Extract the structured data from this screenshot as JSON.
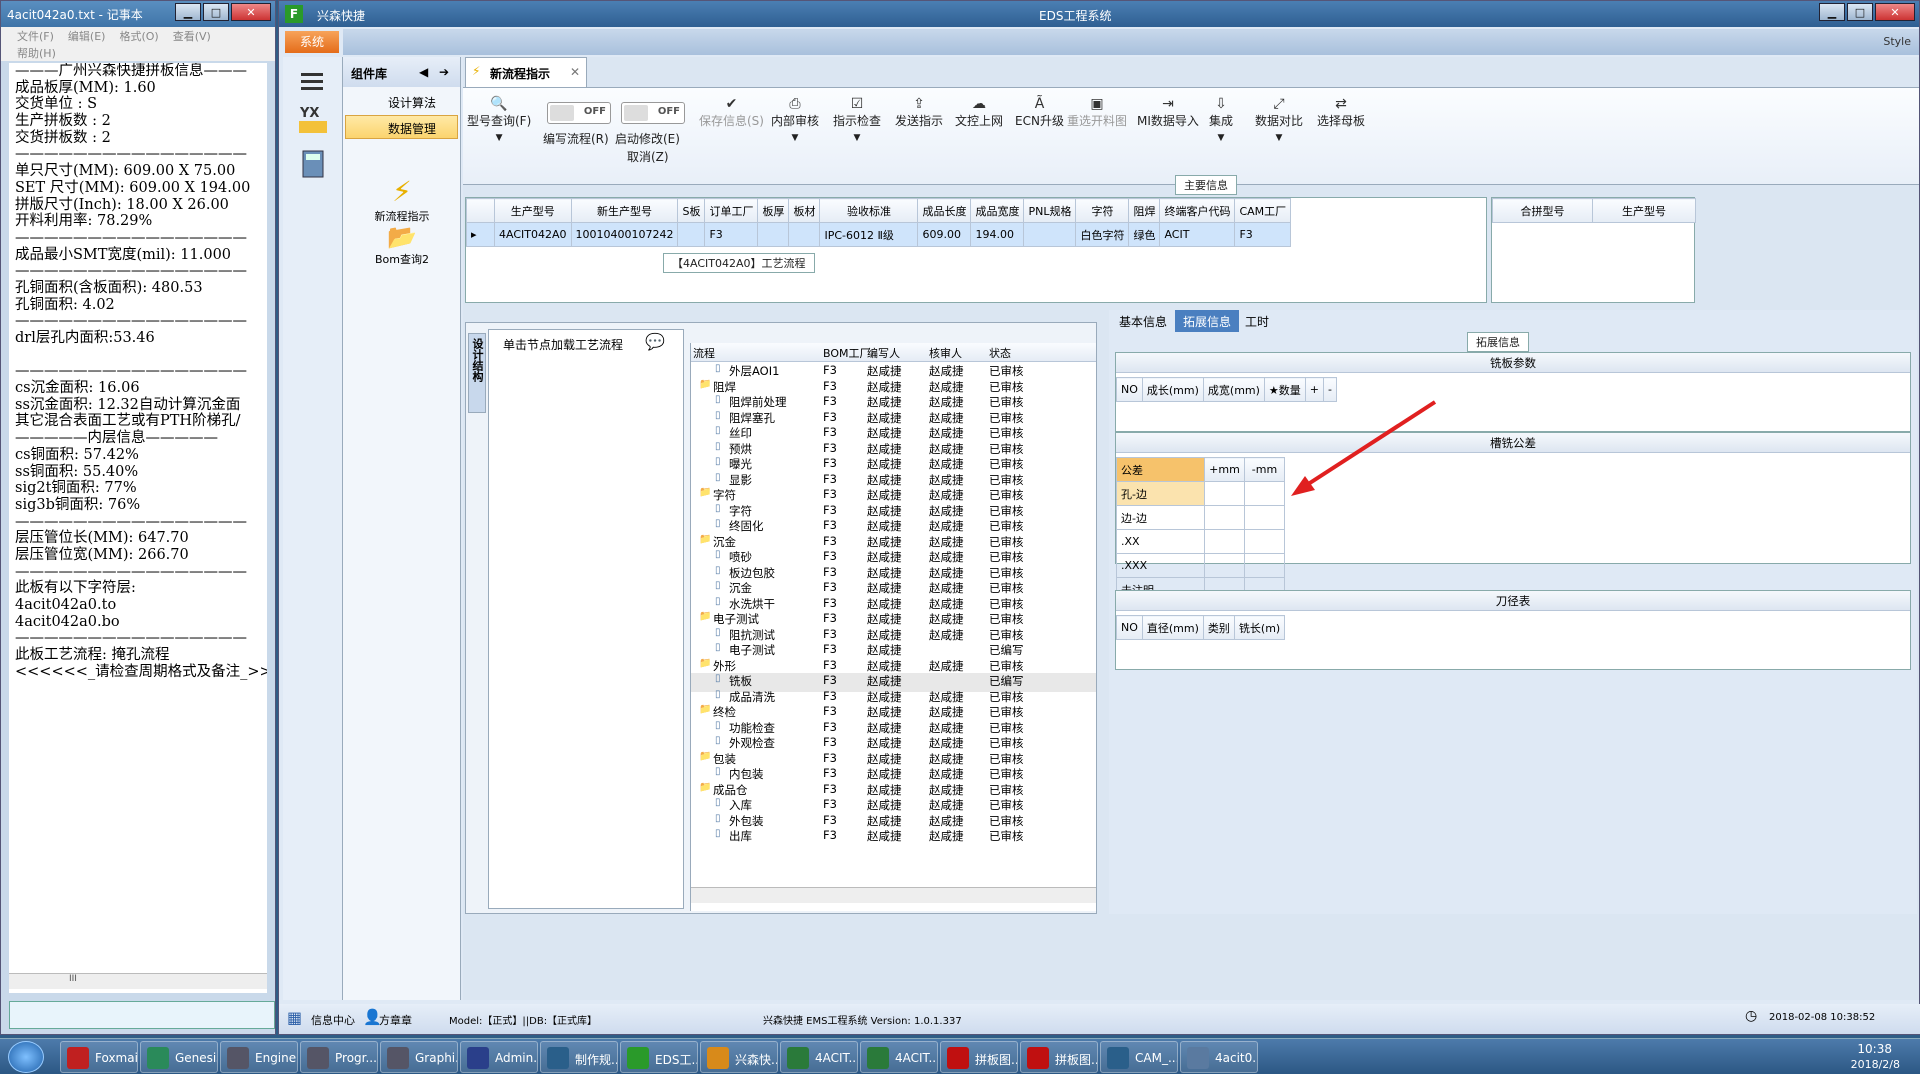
{
  "notepad": {
    "title": "4acit042a0.txt - 记事本",
    "menu": [
      "文件(F)",
      "编辑(E)",
      "格式(O)",
      "查看(V)"
    ],
    "menu2": "帮助(H)",
    "lines": [
      "———广州兴森快捷拼板信息———",
      "成品板厚(MM): 1.60",
      "交货单位 : S",
      "生产拼板数 : 2",
      "交货拼板数 : 2",
      "————————————————",
      "单只尺寸(MM): 609.00 X 75.00",
      "SET 尺寸(MM): 609.00 X 194.00",
      "拼版尺寸(Inch): 18.00 X 26.00",
      "开料利用率: 78.29%",
      "————————————————",
      "成品最小SMT宽度(mil): 11.000",
      "————————————————",
      "孔铜面积(含板面积): 480.53",
      "孔铜面积: 4.02",
      "————————————————",
      "drl层孔内面积:53.46",
      "",
      "————————————————",
      "cs沉金面积: 16.06",
      "ss沉金面积: 12.32自动计算沉金面",
      "其它混合表面工艺或有PTH阶梯孔/",
      "—————内层信息—————",
      "cs铜面积: 57.42%",
      "ss铜面积: 55.40%",
      "sig2t铜面积: 77%",
      "sig3b铜面积: 76%",
      "————————————————",
      "层压管位长(MM): 647.70",
      "层压管位宽(MM): 266.70",
      "————————————————",
      "此板有以下字符层:",
      "4acit042a0.to",
      "4acit042a0.bo",
      "————————————————",
      "此板工艺流程: 掩孔流程",
      "<<<<<<_请检查周期格式及备注_>>"
    ],
    "hscroll_thumb": "III"
  },
  "app": {
    "title_left": "兴森快捷",
    "title_center": "EDS工程系统",
    "style_label": "Style",
    "system_tab": "系统",
    "component_header": "组件库",
    "component_items": [
      "设计算法",
      "数据管理"
    ],
    "big_items": [
      "新流程指示",
      "Bom查询2"
    ],
    "doc_tab": "新流程指示",
    "toolbar": {
      "model_query": "型号查询(F)",
      "edit_flow": "编写流程(R)",
      "auto_modify": "启动修改(E)",
      "cancel": "取消(Z)",
      "toggle_off": "OFF",
      "save_info": "保存信息(S)",
      "internal_review": "内部审核",
      "check_instruction": "指示检查",
      "send_instruction": "发送指示",
      "upload_doc": "文控上网",
      "ecn_upgrade": "ECN升级",
      "reselect_panel": "重选开料图",
      "mi_import": "MI数据导入",
      "integrate": "集成",
      "compare": "数据对比",
      "select_mother": "选择母板"
    },
    "main_info_caption": "主要信息",
    "main_headers": [
      "生产型号",
      "新生产型号",
      "S板",
      "订单工厂",
      "板厚",
      "板材",
      "验收标准",
      "成品长度",
      "成品宽度",
      "PNL规格",
      "字符",
      "阻焊",
      "终端客户代码",
      "CAM工厂"
    ],
    "main_row": [
      "4ACIT042A0",
      "10010400107242",
      "",
      "F3",
      "",
      "",
      "IPC-6012 Ⅱ级",
      "609.00",
      "194.00",
      "",
      "白色字符",
      "绿色",
      "ACIT",
      "F3"
    ],
    "side_headers": [
      "合拼型号",
      "生产型号"
    ],
    "flow_caption": "【4ACIT042A0】工艺流程",
    "side_tab": "设计结构",
    "load_hint": "单击节点加载工艺流程",
    "tree_headers": [
      "流程",
      "BOM工厂",
      "编写人",
      "核审人",
      "状态"
    ],
    "tree_rows": [
      {
        "name": "外层AOI1",
        "level": 2,
        "f": "F3",
        "w": "赵咸捷",
        "r": "赵咸捷",
        "s": "已审核"
      },
      {
        "name": "阻焊",
        "level": 1,
        "f": "F3",
        "w": "赵咸捷",
        "r": "赵咸捷",
        "s": "已审核"
      },
      {
        "name": "阻焊前处理",
        "level": 2,
        "f": "F3",
        "w": "赵咸捷",
        "r": "赵咸捷",
        "s": "已审核"
      },
      {
        "name": "阻焊塞孔",
        "level": 2,
        "f": "F3",
        "w": "赵咸捷",
        "r": "赵咸捷",
        "s": "已审核"
      },
      {
        "name": "丝印",
        "level": 2,
        "f": "F3",
        "w": "赵咸捷",
        "r": "赵咸捷",
        "s": "已审核"
      },
      {
        "name": "预烘",
        "level": 2,
        "f": "F3",
        "w": "赵咸捷",
        "r": "赵咸捷",
        "s": "已审核"
      },
      {
        "name": "曝光",
        "level": 2,
        "f": "F3",
        "w": "赵咸捷",
        "r": "赵咸捷",
        "s": "已审核"
      },
      {
        "name": "显影",
        "level": 2,
        "f": "F3",
        "w": "赵咸捷",
        "r": "赵咸捷",
        "s": "已审核"
      },
      {
        "name": "字符",
        "level": 1,
        "f": "F3",
        "w": "赵咸捷",
        "r": "赵咸捷",
        "s": "已审核"
      },
      {
        "name": "字符",
        "level": 2,
        "f": "F3",
        "w": "赵咸捷",
        "r": "赵咸捷",
        "s": "已审核"
      },
      {
        "name": "终固化",
        "level": 2,
        "f": "F3",
        "w": "赵咸捷",
        "r": "赵咸捷",
        "s": "已审核"
      },
      {
        "name": "沉金",
        "level": 1,
        "f": "F3",
        "w": "赵咸捷",
        "r": "赵咸捷",
        "s": "已审核"
      },
      {
        "name": "喷砂",
        "level": 2,
        "f": "F3",
        "w": "赵咸捷",
        "r": "赵咸捷",
        "s": "已审核"
      },
      {
        "name": "板边包胶",
        "level": 2,
        "f": "F3",
        "w": "赵咸捷",
        "r": "赵咸捷",
        "s": "已审核"
      },
      {
        "name": "沉金",
        "level": 2,
        "f": "F3",
        "w": "赵咸捷",
        "r": "赵咸捷",
        "s": "已审核"
      },
      {
        "name": "水洗烘干",
        "level": 2,
        "f": "F3",
        "w": "赵咸捷",
        "r": "赵咸捷",
        "s": "已审核"
      },
      {
        "name": "电子测试",
        "level": 1,
        "f": "F3",
        "w": "赵咸捷",
        "r": "赵咸捷",
        "s": "已审核"
      },
      {
        "name": "阻抗测试",
        "level": 2,
        "f": "F3",
        "w": "赵咸捷",
        "r": "赵咸捷",
        "s": "已审核"
      },
      {
        "name": "电子测试",
        "level": 2,
        "f": "F3",
        "w": "赵咸捷",
        "r": "",
        "s": "已编写"
      },
      {
        "name": "外形",
        "level": 1,
        "f": "F3",
        "w": "赵咸捷",
        "r": "赵咸捷",
        "s": "已审核"
      },
      {
        "name": "铣板",
        "level": 2,
        "f": "F3",
        "w": "赵咸捷",
        "r": "",
        "s": "已编写"
      },
      {
        "name": "成品清洗",
        "level": 2,
        "f": "F3",
        "w": "赵咸捷",
        "r": "赵咸捷",
        "s": "已审核"
      },
      {
        "name": "终检",
        "level": 1,
        "f": "F3",
        "w": "赵咸捷",
        "r": "赵咸捷",
        "s": "已审核"
      },
      {
        "name": "功能检查",
        "level": 2,
        "f": "F3",
        "w": "赵咸捷",
        "r": "赵咸捷",
        "s": "已审核"
      },
      {
        "name": "外观检查",
        "level": 2,
        "f": "F3",
        "w": "赵咸捷",
        "r": "赵咸捷",
        "s": "已审核"
      },
      {
        "name": "包装",
        "level": 1,
        "f": "F3",
        "w": "赵咸捷",
        "r": "赵咸捷",
        "s": "已审核"
      },
      {
        "name": "内包装",
        "level": 2,
        "f": "F3",
        "w": "赵咸捷",
        "r": "赵咸捷",
        "s": "已审核"
      },
      {
        "name": "成品仓",
        "level": 1,
        "f": "F3",
        "w": "赵咸捷",
        "r": "赵咸捷",
        "s": "已审核"
      },
      {
        "name": "入库",
        "level": 2,
        "f": "F3",
        "w": "赵咸捷",
        "r": "赵咸捷",
        "s": "已审核"
      },
      {
        "name": "外包装",
        "level": 2,
        "f": "F3",
        "w": "赵咸捷",
        "r": "赵咸捷",
        "s": "已审核"
      },
      {
        "name": "出库",
        "level": 2,
        "f": "F3",
        "w": "赵咸捷",
        "r": "赵咸捷",
        "s": "已审核"
      }
    ],
    "detail_tabs": [
      "基本信息",
      "拓展信息",
      "工时"
    ],
    "ext_caption": "拓展信息",
    "mill_params": {
      "title": "铣板参数",
      "headers": [
        "NO",
        "成长(mm)",
        "成宽(mm)",
        "★数量",
        "+",
        "-"
      ]
    },
    "tolerance": {
      "title": "槽铣公差",
      "headers": [
        "公差",
        "+mm",
        "-mm"
      ],
      "rows": [
        "孔-边",
        "边-边",
        ".XX",
        ".XXX",
        "未注明"
      ]
    },
    "cutter": {
      "title": "刀径表",
      "headers": [
        "NO",
        "直径(mm)",
        "类别",
        "铣长(m)"
      ]
    },
    "status": {
      "info_center": "信息中心",
      "user": "方章章",
      "model": "Model:【正式】||DB:【正式库】",
      "version": "兴森快捷 EMS工程系统 Version: 1.0.1.337",
      "datetime": "2018-02-08 10:38:52"
    }
  },
  "taskbar": {
    "tasks": [
      "Foxmail",
      "Genesis",
      "Engine...",
      "Progr...",
      "Graphi...",
      "Admin...",
      "制作规...",
      "EDS工...",
      "兴森快...",
      "4ACIT...",
      "4ACIT...",
      "拼板图...",
      "拼板图...",
      "CAM_...",
      "4acit0..."
    ],
    "time": "10:38",
    "date": "2018/2/8"
  },
  "colors": {
    "selection": "#cfe4fb",
    "accent_orange": "#e46c1a",
    "arrow": "#e02020",
    "tol_header": "#f6c26b"
  }
}
